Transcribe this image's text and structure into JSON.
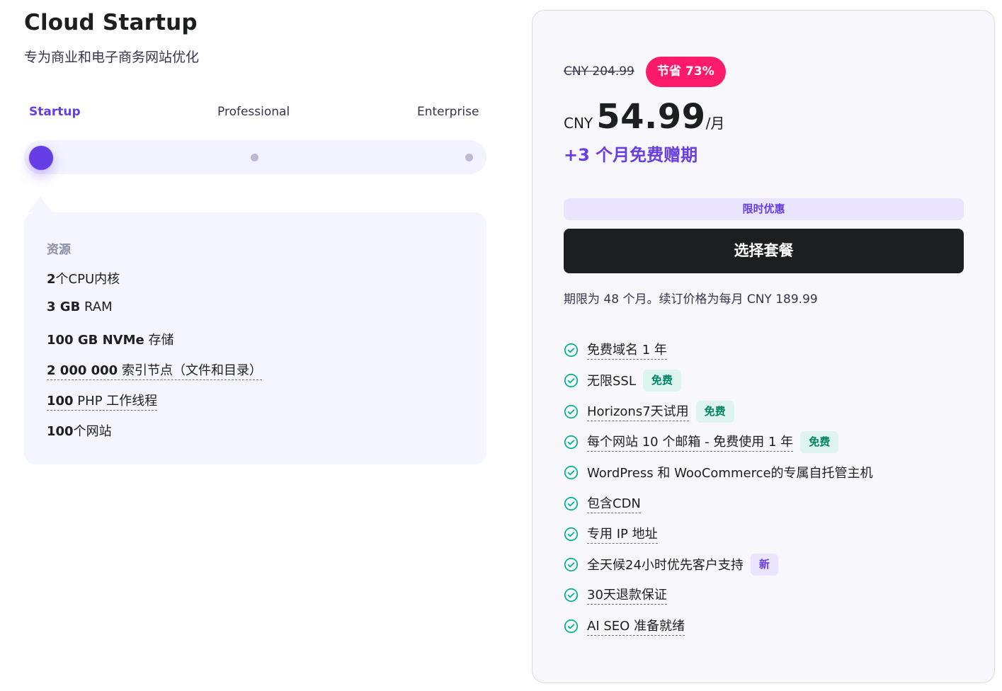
{
  "plan": {
    "title": "Cloud Startup",
    "subtitle": "专为商业和电子商务网站优化"
  },
  "tiers": {
    "items": [
      "Startup",
      "Professional",
      "Enterprise"
    ],
    "selected": "Startup"
  },
  "resources": {
    "heading": "资源",
    "items": [
      {
        "strong": "2",
        "rest": "个CPU内核"
      },
      {
        "strong": "3 GB",
        "rest": " RAM"
      },
      {
        "strong": "100 GB NVMe",
        "rest": " 存储"
      },
      {
        "strong": "2 000 000",
        "rest": " 索引节点（文件和目录）"
      },
      {
        "strong": "100",
        "rest": " PHP 工作线程"
      },
      {
        "strong": "100",
        "rest": "个网站"
      }
    ]
  },
  "pricing": {
    "old_price": "CNY 204.99",
    "save_badge": "节省 73%",
    "currency": "CNY",
    "amount": "54.99",
    "unit": "/月",
    "bonus": "+3 个月免费赠期",
    "promo_label": "限时优惠",
    "cta_label": "选择套餐",
    "term_note": "期限为 48 个月。续订价格为每月 CNY 189.99"
  },
  "features": [
    {
      "label": "免费域名 1 年",
      "badge": ""
    },
    {
      "label": "无限SSL",
      "badge": "免费"
    },
    {
      "label": "Horizons7天试用",
      "badge": "免费"
    },
    {
      "label": "每个网站 10 个邮箱 - 免费使用 1 年",
      "badge": "免费"
    },
    {
      "label": "WordPress 和 WooCommerce的专属自托管主机",
      "badge": ""
    },
    {
      "label": "包含CDN",
      "badge": ""
    },
    {
      "label": "专用 IP 地址",
      "badge": ""
    },
    {
      "label": "全天候24小时优先客户支持",
      "badge": "新"
    },
    {
      "label": "30天退款保证",
      "badge": ""
    },
    {
      "label": "AI SEO 准备就绪",
      "badge": ""
    }
  ],
  "colors": {
    "accent": "#673de6",
    "save_badge": "#fc1b6a",
    "check": "#00b090",
    "cta": "#1d1e20"
  },
  "icons": {
    "feature_check": "check-circle-icon"
  }
}
